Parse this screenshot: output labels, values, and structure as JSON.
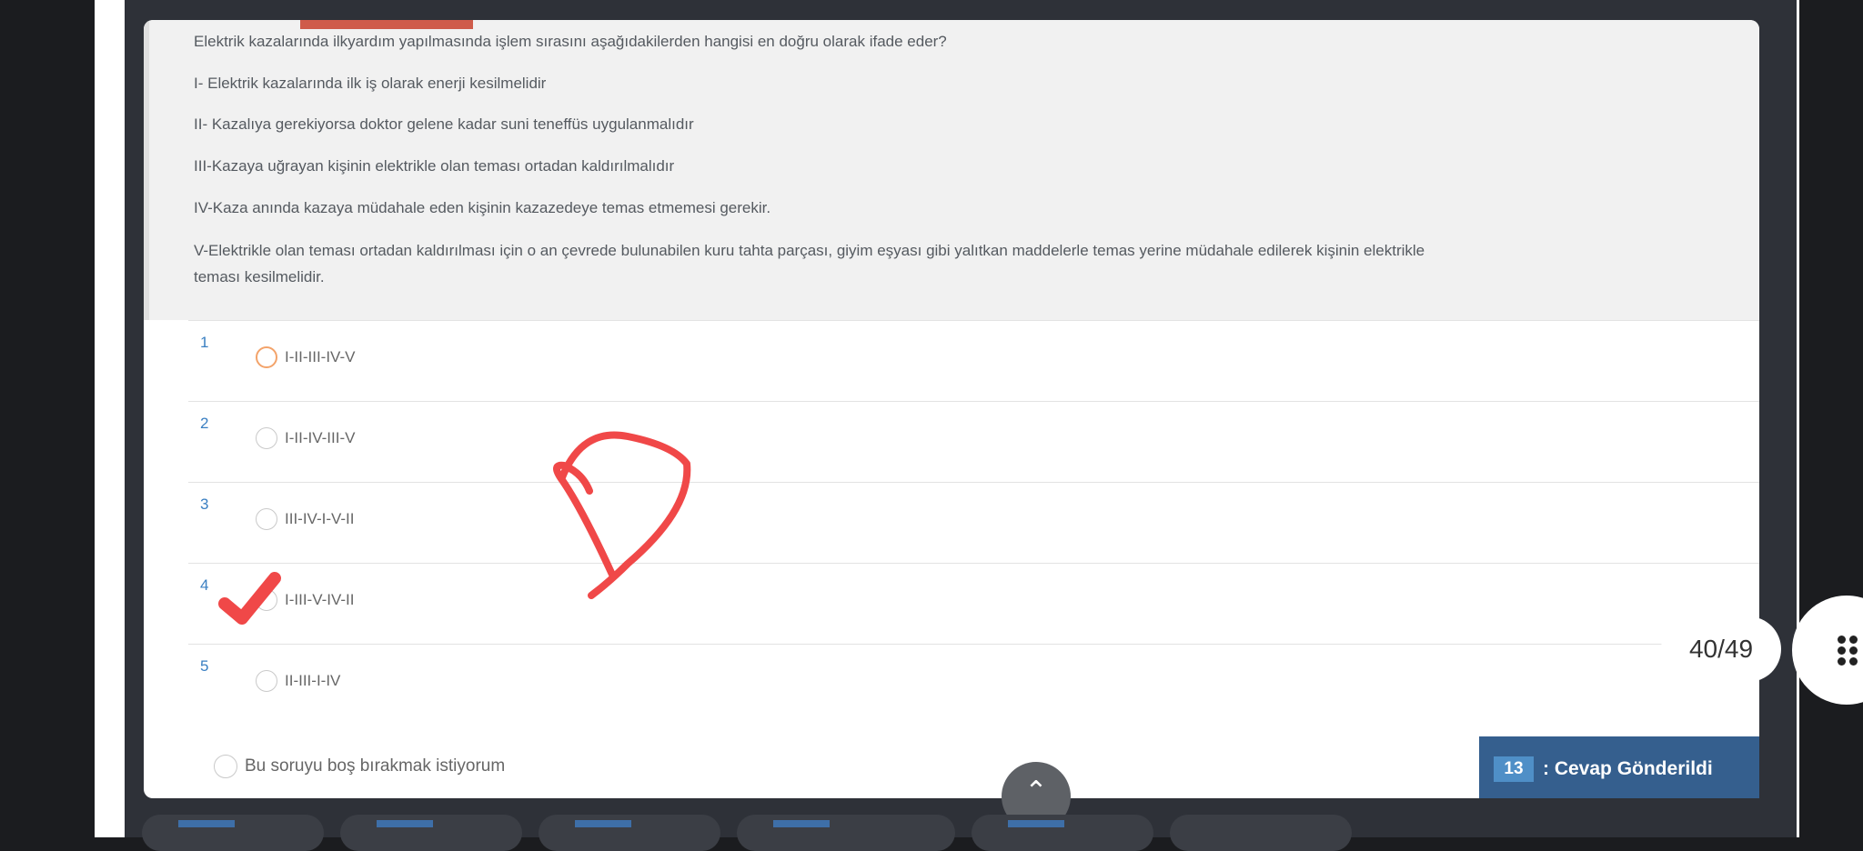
{
  "question": {
    "lines": [
      "Elektrik kazalarında ilkyardım yapılmasında işlem sırasını aşağıdakilerden hangisi en doğru olarak ifade eder?",
      "I- Elektrik kazalarında ilk iş olarak enerji kesilmelidir",
      "II- Kazalıya gerekiyorsa doktor gelene kadar suni teneffüs uygulanmalıdır",
      "III-Kazaya uğrayan kişinin elektrikle olan teması ortadan kaldırılmalıdır",
      "IV-Kaza anında kazaya müdahale eden kişinin kazazedeye temas etmemesi gerekir.",
      "V-Elektrikle olan teması ortadan kaldırılması için o an çevrede bulunabilen kuru tahta parçası, giyim eşyası gibi yalıtkan maddelerle temas yerine müdahale edilerek kişinin elektrikle",
      "teması kesilmelidir."
    ]
  },
  "options": [
    {
      "number": "1",
      "text": "I-II-III-IV-V"
    },
    {
      "number": "2",
      "text": "I-II-IV-III-V"
    },
    {
      "number": "3",
      "text": "III-IV-I-V-II"
    },
    {
      "number": "4",
      "text": "I-III-V-IV-II"
    },
    {
      "number": "5",
      "text": "II-III-I-IV"
    }
  ],
  "skip": {
    "label": "Bu soruyu boş bırakmak istiyorum"
  },
  "status": {
    "number": "13",
    "text": ": Cevap Gönderildi"
  },
  "page_counter": "40/49",
  "annotation": {
    "letter": "D",
    "color": "#f04848",
    "checked_option": "4"
  },
  "colors": {
    "accent": "#3a7fc2",
    "badge": "#355f8e",
    "red_strip": "#cf5b4a"
  }
}
